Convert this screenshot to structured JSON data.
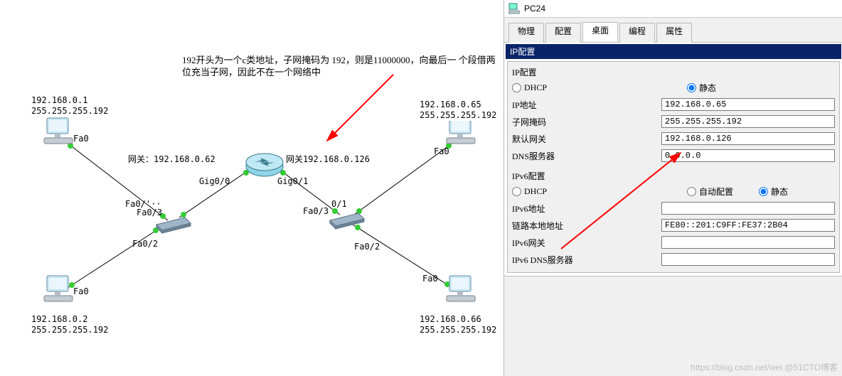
{
  "note": "192开头为一个c类地址，子网掩码为\n192，则是11000000，向最后一\n个段借两位充当子网，因此不在一个网络中",
  "devices": {
    "pc_tl": {
      "ip": "192.168.0.1",
      "mask": "255.255.255.192",
      "port": "Fa0"
    },
    "pc_bl": {
      "ip": "192.168.0.2",
      "mask": "255.255.255.192",
      "port": "Fa0"
    },
    "pc_tr": {
      "ip": "192.168.0.65",
      "mask": "255.255.255.192",
      "port": "Fa0"
    },
    "pc_br": {
      "ip": "192.168.0.66",
      "mask": "255.255.255.192",
      "port": "Fa0"
    },
    "gw_left_lbl": "网关：192.168.0.62",
    "gw_right_lbl": "网关192.168.0.126",
    "rtr_left_port": "Gig0/0",
    "rtr_right_port": "Gig0/1",
    "sw_l_up": "Fa0/'··",
    "sw_l_up2": "Fa0/3",
    "sw_l_down": "Fa0/2",
    "sw_r_up": "Fa0/3",
    "sw_r_up2": "0/1",
    "sw_r_down": "Fa0/2"
  },
  "window": {
    "title": "PC24",
    "tabs": [
      "物理",
      "配置",
      "桌面",
      "编程",
      "属性"
    ],
    "active_tab": "桌面",
    "section": "IP配置",
    "ipcfg": {
      "hdr": "IP配置",
      "dhcp": "DHCP",
      "static": "静态",
      "ip_lbl": "IP地址",
      "ip_val": "192.168.0.65",
      "mask_lbl": "子网掩码",
      "mask_val": "255.255.255.192",
      "gw_lbl": "默认网关",
      "gw_val": "192.168.0.126",
      "dns_lbl": "DNS服务器",
      "dns_val": "0.0.0.0"
    },
    "ipv6": {
      "hdr": "IPv6配置",
      "dhcp": "DHCP",
      "auto": "自动配置",
      "static": "静态",
      "addr_lbl": "IPv6地址",
      "addr_val": "",
      "ll_lbl": "链路本地地址",
      "ll_val": "FE80::201:C9FF:FE37:2B04",
      "gw_lbl": "IPv6网关",
      "gw_val": "",
      "dns_lbl": "IPv6 DNS服务器",
      "dns_val": ""
    }
  },
  "watermark": "https://blog.csdn.net/wei @51CTO博客"
}
